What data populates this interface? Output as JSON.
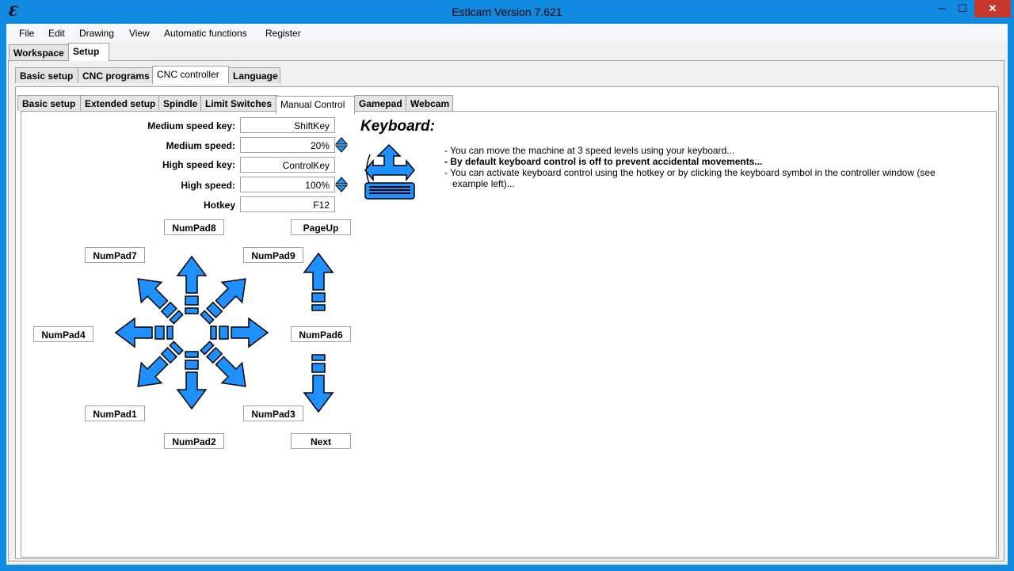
{
  "window": {
    "title": "Estlcam Version 7.621",
    "min_glyph": "─",
    "max_glyph": "☐",
    "close_glyph": "✕"
  },
  "menu": [
    "File",
    "Edit",
    "Drawing",
    "View",
    "Automatic functions",
    "Register"
  ],
  "main_tabs": [
    "Workspace",
    "Setup"
  ],
  "setup_tabs": [
    "Basic setup",
    "CNC programs",
    "CNC controller",
    "Language"
  ],
  "controller_tabs": [
    "Basic setup",
    "Extended setup",
    "Spindle",
    "Limit Switches",
    "Manual Control",
    "Gamepad",
    "Webcam"
  ],
  "fields": {
    "medium_speed_key": {
      "label": "Medium speed key:",
      "value": "ShiftKey"
    },
    "medium_speed": {
      "label": "Medium speed:",
      "value": "20%"
    },
    "high_speed_key": {
      "label": "High speed key:",
      "value": "ControlKey"
    },
    "high_speed": {
      "label": "High speed:",
      "value": "100%"
    },
    "hotkey": {
      "label": "Hotkey",
      "value": "F12"
    }
  },
  "keys": {
    "numpad8": "NumPad8",
    "pageup": "PageUp",
    "numpad7": "NumPad7",
    "numpad9": "NumPad9",
    "numpad4": "NumPad4",
    "numpad6": "NumPad6",
    "numpad1": "NumPad1",
    "numpad3": "NumPad3",
    "numpad2": "NumPad2",
    "next": "Next"
  },
  "keyboard": {
    "heading": "Keyboard:",
    "lines": [
      "- You can move the machine at 3 speed levels using your keyboard...",
      "- By default keyboard control is off to prevent accidental movements...",
      "- You can activate keyboard control using the hotkey or by clicking the keyboard symbol in the controller window (see",
      "example left)..."
    ]
  },
  "colors": {
    "arrow_fill": "#1e90ff",
    "arrow_stroke": "#000000",
    "titlebar": "#0f8ae0"
  }
}
